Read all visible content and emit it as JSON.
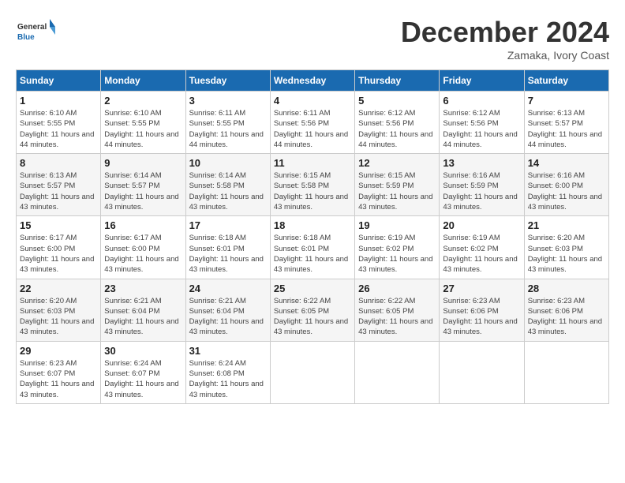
{
  "logo": {
    "text_general": "General",
    "text_blue": "Blue"
  },
  "title": "December 2024",
  "location": "Zamaka, Ivory Coast",
  "days_of_week": [
    "Sunday",
    "Monday",
    "Tuesday",
    "Wednesday",
    "Thursday",
    "Friday",
    "Saturday"
  ],
  "weeks": [
    [
      {
        "day": "1",
        "info": "Sunrise: 6:10 AM\nSunset: 5:55 PM\nDaylight: 11 hours and 44 minutes."
      },
      {
        "day": "2",
        "info": "Sunrise: 6:10 AM\nSunset: 5:55 PM\nDaylight: 11 hours and 44 minutes."
      },
      {
        "day": "3",
        "info": "Sunrise: 6:11 AM\nSunset: 5:55 PM\nDaylight: 11 hours and 44 minutes."
      },
      {
        "day": "4",
        "info": "Sunrise: 6:11 AM\nSunset: 5:56 PM\nDaylight: 11 hours and 44 minutes."
      },
      {
        "day": "5",
        "info": "Sunrise: 6:12 AM\nSunset: 5:56 PM\nDaylight: 11 hours and 44 minutes."
      },
      {
        "day": "6",
        "info": "Sunrise: 6:12 AM\nSunset: 5:56 PM\nDaylight: 11 hours and 44 minutes."
      },
      {
        "day": "7",
        "info": "Sunrise: 6:13 AM\nSunset: 5:57 PM\nDaylight: 11 hours and 44 minutes."
      }
    ],
    [
      {
        "day": "8",
        "info": "Sunrise: 6:13 AM\nSunset: 5:57 PM\nDaylight: 11 hours and 43 minutes."
      },
      {
        "day": "9",
        "info": "Sunrise: 6:14 AM\nSunset: 5:57 PM\nDaylight: 11 hours and 43 minutes."
      },
      {
        "day": "10",
        "info": "Sunrise: 6:14 AM\nSunset: 5:58 PM\nDaylight: 11 hours and 43 minutes."
      },
      {
        "day": "11",
        "info": "Sunrise: 6:15 AM\nSunset: 5:58 PM\nDaylight: 11 hours and 43 minutes."
      },
      {
        "day": "12",
        "info": "Sunrise: 6:15 AM\nSunset: 5:59 PM\nDaylight: 11 hours and 43 minutes."
      },
      {
        "day": "13",
        "info": "Sunrise: 6:16 AM\nSunset: 5:59 PM\nDaylight: 11 hours and 43 minutes."
      },
      {
        "day": "14",
        "info": "Sunrise: 6:16 AM\nSunset: 6:00 PM\nDaylight: 11 hours and 43 minutes."
      }
    ],
    [
      {
        "day": "15",
        "info": "Sunrise: 6:17 AM\nSunset: 6:00 PM\nDaylight: 11 hours and 43 minutes."
      },
      {
        "day": "16",
        "info": "Sunrise: 6:17 AM\nSunset: 6:00 PM\nDaylight: 11 hours and 43 minutes."
      },
      {
        "day": "17",
        "info": "Sunrise: 6:18 AM\nSunset: 6:01 PM\nDaylight: 11 hours and 43 minutes."
      },
      {
        "day": "18",
        "info": "Sunrise: 6:18 AM\nSunset: 6:01 PM\nDaylight: 11 hours and 43 minutes."
      },
      {
        "day": "19",
        "info": "Sunrise: 6:19 AM\nSunset: 6:02 PM\nDaylight: 11 hours and 43 minutes."
      },
      {
        "day": "20",
        "info": "Sunrise: 6:19 AM\nSunset: 6:02 PM\nDaylight: 11 hours and 43 minutes."
      },
      {
        "day": "21",
        "info": "Sunrise: 6:20 AM\nSunset: 6:03 PM\nDaylight: 11 hours and 43 minutes."
      }
    ],
    [
      {
        "day": "22",
        "info": "Sunrise: 6:20 AM\nSunset: 6:03 PM\nDaylight: 11 hours and 43 minutes."
      },
      {
        "day": "23",
        "info": "Sunrise: 6:21 AM\nSunset: 6:04 PM\nDaylight: 11 hours and 43 minutes."
      },
      {
        "day": "24",
        "info": "Sunrise: 6:21 AM\nSunset: 6:04 PM\nDaylight: 11 hours and 43 minutes."
      },
      {
        "day": "25",
        "info": "Sunrise: 6:22 AM\nSunset: 6:05 PM\nDaylight: 11 hours and 43 minutes."
      },
      {
        "day": "26",
        "info": "Sunrise: 6:22 AM\nSunset: 6:05 PM\nDaylight: 11 hours and 43 minutes."
      },
      {
        "day": "27",
        "info": "Sunrise: 6:23 AM\nSunset: 6:06 PM\nDaylight: 11 hours and 43 minutes."
      },
      {
        "day": "28",
        "info": "Sunrise: 6:23 AM\nSunset: 6:06 PM\nDaylight: 11 hours and 43 minutes."
      }
    ],
    [
      {
        "day": "29",
        "info": "Sunrise: 6:23 AM\nSunset: 6:07 PM\nDaylight: 11 hours and 43 minutes."
      },
      {
        "day": "30",
        "info": "Sunrise: 6:24 AM\nSunset: 6:07 PM\nDaylight: 11 hours and 43 minutes."
      },
      {
        "day": "31",
        "info": "Sunrise: 6:24 AM\nSunset: 6:08 PM\nDaylight: 11 hours and 43 minutes."
      },
      null,
      null,
      null,
      null
    ]
  ]
}
